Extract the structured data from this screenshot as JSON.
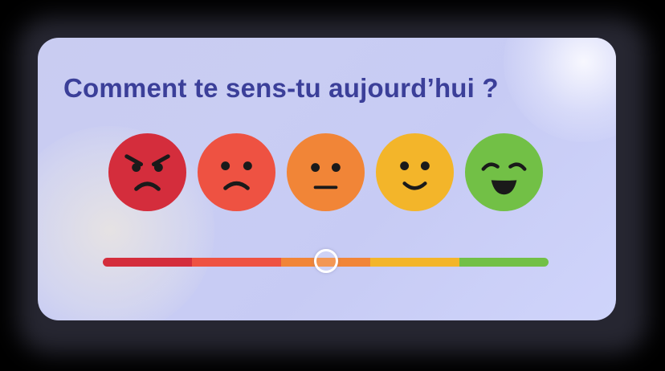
{
  "title": "Comment te sens-tu aujourd’hui ?",
  "colors": {
    "title": "#3b3f99",
    "card_background": "#c9ccf1",
    "face_features": "#1a1a1a"
  },
  "faces": [
    {
      "mood": "angry",
      "icon": "angry-face-icon",
      "color": "#d42d3c"
    },
    {
      "mood": "sad",
      "icon": "sad-face-icon",
      "color": "#ee5242"
    },
    {
      "mood": "neutral",
      "icon": "neutral-face-icon",
      "color": "#f18537"
    },
    {
      "mood": "happy",
      "icon": "smiling-face-icon",
      "color": "#f3b52a"
    },
    {
      "mood": "very-happy",
      "icon": "grinning-face-icon",
      "color": "#72c046"
    }
  ],
  "slider": {
    "segments": [
      "#d42d3c",
      "#ee5242",
      "#f18537",
      "#f3b52a",
      "#72c046"
    ],
    "value_fraction": 0.5
  }
}
